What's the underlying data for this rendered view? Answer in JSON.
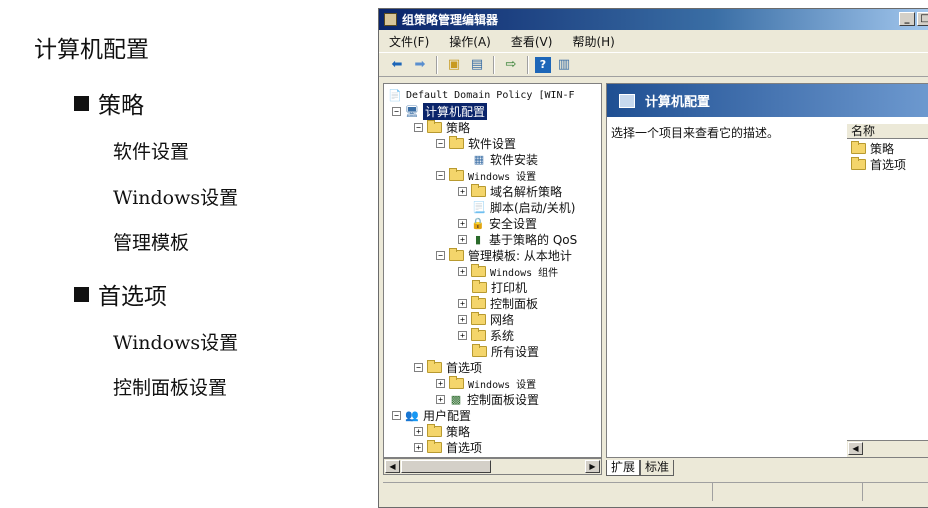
{
  "slide": {
    "title": "计算机配置",
    "sections": [
      {
        "label": "策略",
        "items": [
          "软件设置",
          "Windows设置",
          "管理模板"
        ]
      },
      {
        "label": "首选项",
        "items": [
          "Windows设置",
          "控制面板设置"
        ]
      }
    ]
  },
  "window": {
    "title": "组策略管理编辑器",
    "buttons": {
      "minimize": "_",
      "restore": "□"
    },
    "menu": [
      "文件(F)",
      "操作(A)",
      "查看(V)",
      "帮助(H)"
    ],
    "tree": {
      "root": "Default Domain Policy [WIN-F",
      "items": {
        "computer_config": "计算机配置",
        "policies": "策略",
        "software_settings": "软件设置",
        "software_install": "软件安装",
        "windows_settings": "Windows 设置",
        "dns_policy": "域名解析策略",
        "scripts": "脚本(启动/关机)",
        "security_settings": "安全设置",
        "qos": "基于策略的 QoS",
        "admin_templates": "管理模板: 从本地计",
        "windows_components": "Windows 组件",
        "printers": "打印机",
        "control_panel": "控制面板",
        "network": "网络",
        "system": "系统",
        "all_settings": "所有设置",
        "preferences": "首选项",
        "pref_windows_settings": "Windows 设置",
        "pref_control_panel": "控制面板设置",
        "user_config": "用户配置",
        "user_policies": "策略",
        "user_preferences": "首选项"
      }
    },
    "detail": {
      "header": "计算机配置",
      "description": "选择一个项目来查看它的描述。",
      "column": "名称",
      "items": [
        "策略",
        "首选项"
      ]
    },
    "tabs": [
      "扩展",
      "标准"
    ]
  }
}
